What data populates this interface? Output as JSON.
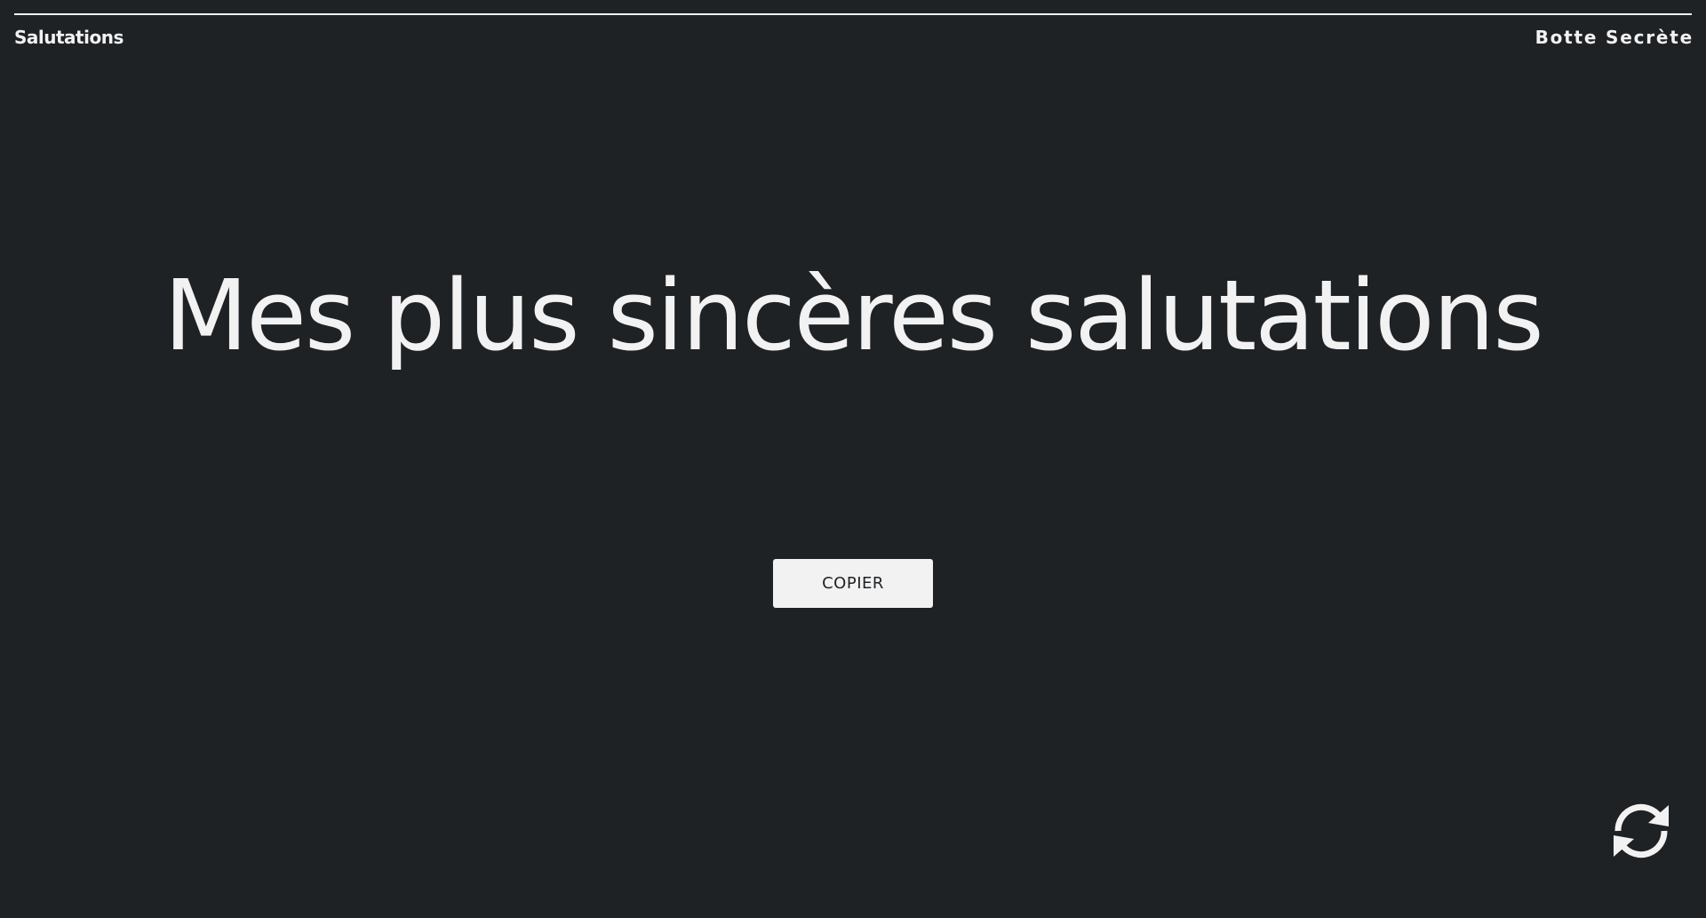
{
  "header": {
    "left_label": "Salutations",
    "right_label": "Botte Secrète"
  },
  "main": {
    "headline": "Mes plus sincères salutations",
    "copy_button_label": "COPIER"
  },
  "actions": {
    "refresh_icon": "refresh-icon"
  },
  "colors": {
    "background": "#1f2225",
    "foreground": "#f2f2f2",
    "button_background": "#f2f2f2",
    "button_text": "#1f2225"
  }
}
